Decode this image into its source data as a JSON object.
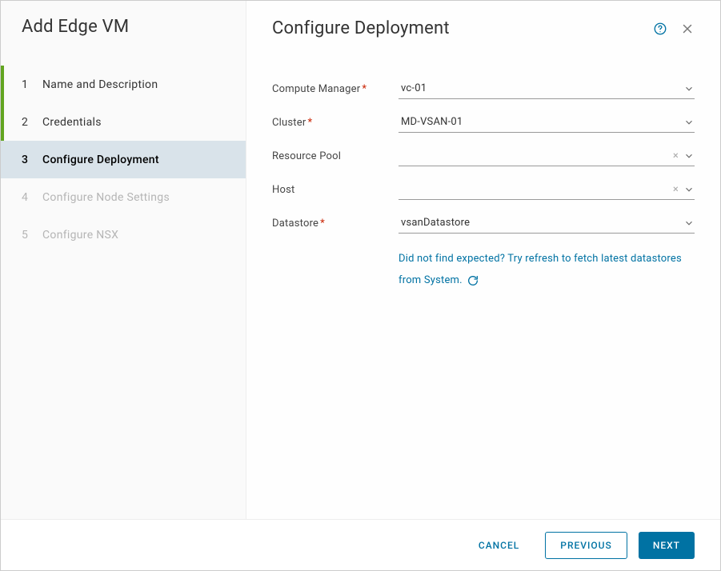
{
  "sidebar": {
    "title": "Add Edge VM",
    "steps": [
      {
        "num": "1",
        "label": "Name and Description"
      },
      {
        "num": "2",
        "label": "Credentials"
      },
      {
        "num": "3",
        "label": "Configure Deployment"
      },
      {
        "num": "4",
        "label": "Configure Node Settings"
      },
      {
        "num": "5",
        "label": "Configure NSX"
      }
    ]
  },
  "main": {
    "title": "Configure Deployment",
    "fields": {
      "compute_manager": {
        "label": "Compute Manager",
        "required": true,
        "value": "vc-01",
        "clearable": false
      },
      "cluster": {
        "label": "Cluster",
        "required": true,
        "value": "MD-VSAN-01",
        "clearable": false
      },
      "resource_pool": {
        "label": "Resource Pool",
        "required": false,
        "value": "",
        "clearable": true
      },
      "host": {
        "label": "Host",
        "required": false,
        "value": "",
        "clearable": true
      },
      "datastore": {
        "label": "Datastore",
        "required": true,
        "value": "vsanDatastore",
        "clearable": false
      }
    },
    "hint": "Did not find expected? Try refresh to fetch latest datastores from System."
  },
  "footer": {
    "cancel": "CANCEL",
    "previous": "PREVIOUS",
    "next": "NEXT"
  }
}
